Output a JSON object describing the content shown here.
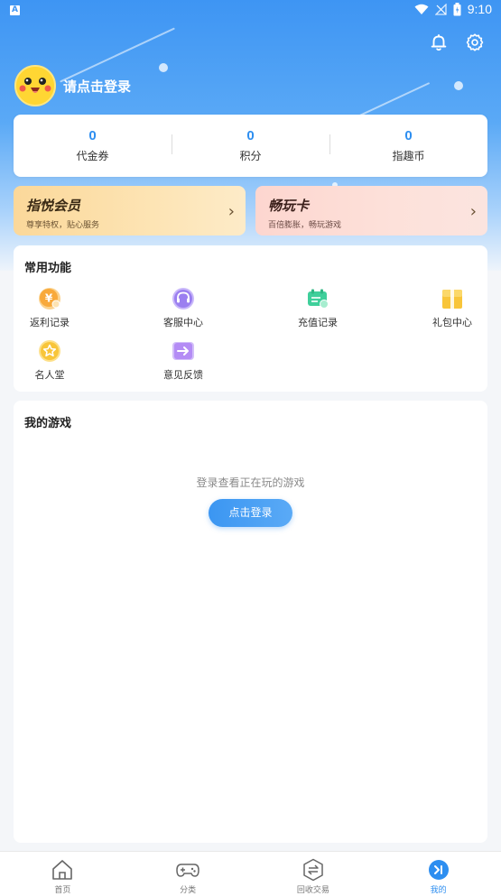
{
  "status_bar": {
    "time": "9:10",
    "notification_icon": "A"
  },
  "header": {
    "bell_icon": "bell-icon",
    "settings_icon": "gear-icon",
    "login_prompt": "请点击登录"
  },
  "stats": [
    {
      "value": "0",
      "label": "代金券"
    },
    {
      "value": "0",
      "label": "积分"
    },
    {
      "value": "0",
      "label": "指趣币"
    }
  ],
  "promos": {
    "vip": {
      "title": "指悦会员",
      "subtitle": "尊享特权，贴心服务"
    },
    "card": {
      "title": "畅玩卡",
      "subtitle": "百倍膨胀，畅玩游戏"
    }
  },
  "common_functions": {
    "title": "常用功能",
    "items": [
      {
        "label": "返利记录",
        "icon": "rebate-icon",
        "color": "#f8a93b"
      },
      {
        "label": "客服中心",
        "icon": "headset-icon",
        "color": "#9b7ff0"
      },
      {
        "label": "充值记录",
        "icon": "recharge-icon",
        "color": "#3fcf9b"
      },
      {
        "label": "礼包中心",
        "icon": "gift-icon",
        "color": "#f8c53a"
      },
      {
        "label": "名人堂",
        "icon": "star-icon",
        "color": "#f8c53a"
      },
      {
        "label": "意见反馈",
        "icon": "feedback-icon",
        "color": "#b48cf5"
      }
    ]
  },
  "my_games": {
    "title": "我的游戏",
    "empty_text": "登录查看正在玩的游戏",
    "login_button": "点击登录"
  },
  "tabs": [
    {
      "label": "首页",
      "icon": "home-icon",
      "active": false
    },
    {
      "label": "分类",
      "icon": "gamepad-icon",
      "active": false
    },
    {
      "label": "回收交易",
      "icon": "exchange-icon",
      "active": false
    },
    {
      "label": "我的",
      "icon": "profile-icon",
      "active": true
    }
  ],
  "colors": {
    "accent": "#2d8ef0",
    "hero_top": "#3e95f3"
  }
}
